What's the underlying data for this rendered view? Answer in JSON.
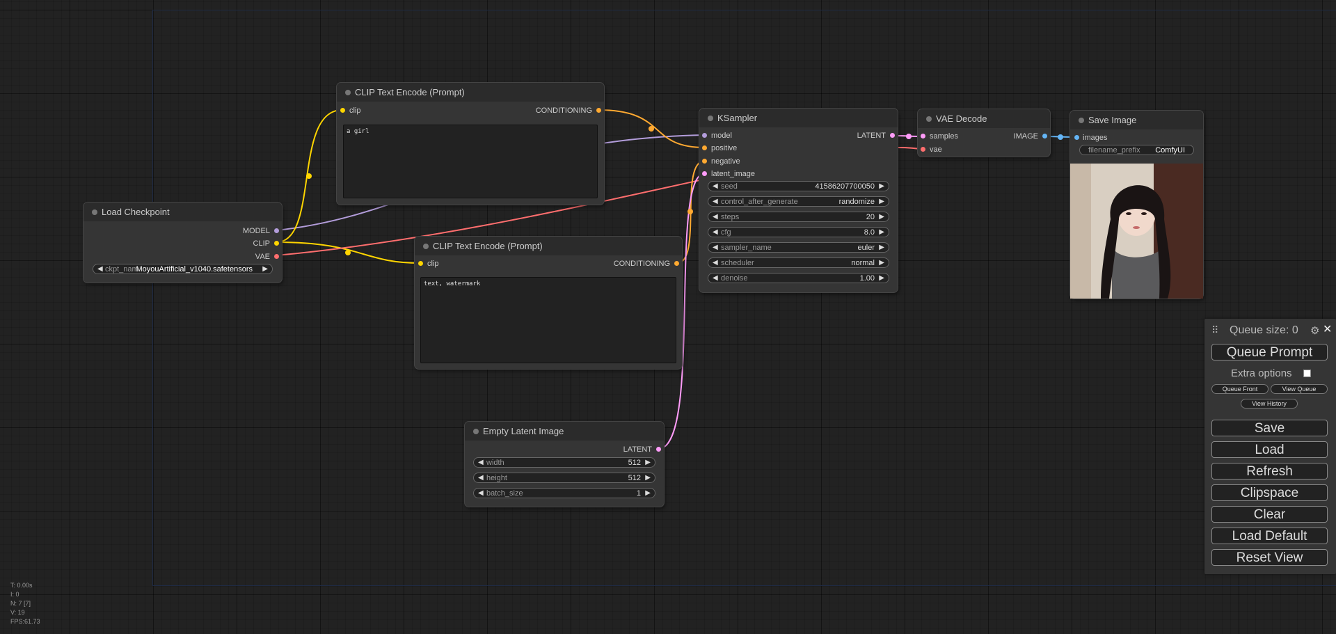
{
  "nodes": {
    "clip_top": {
      "title": "CLIP Text Encode (Prompt)",
      "input": "clip",
      "output": "CONDITIONING",
      "text": "a girl"
    },
    "clip_bottom": {
      "title": "CLIP Text Encode (Prompt)",
      "input": "clip",
      "output": "CONDITIONING",
      "text": "text, watermark"
    },
    "load_checkpoint": {
      "title": "Load Checkpoint",
      "outputs": [
        "MODEL",
        "CLIP",
        "VAE"
      ],
      "ckpt_label": "ckpt_nam",
      "ckpt_value": "MoyouArtificial_v1040.safetensors"
    },
    "ksampler": {
      "title": "KSampler",
      "inputs": [
        "model",
        "positive",
        "negative",
        "latent_image"
      ],
      "output": "LATENT",
      "widgets": [
        {
          "label": "seed",
          "value": "41586207700050"
        },
        {
          "label": "control_after_generate",
          "value": "randomize"
        },
        {
          "label": "steps",
          "value": "20"
        },
        {
          "label": "cfg",
          "value": "8.0"
        },
        {
          "label": "sampler_name",
          "value": "euler"
        },
        {
          "label": "scheduler",
          "value": "normal"
        },
        {
          "label": "denoise",
          "value": "1.00"
        }
      ]
    },
    "vae_decode": {
      "title": "VAE Decode",
      "inputs": [
        "samples",
        "vae"
      ],
      "output": "IMAGE"
    },
    "save_image": {
      "title": "Save Image",
      "input": "images",
      "prefix_label": "filename_prefix",
      "prefix_value": "ComfyUI"
    },
    "empty_latent": {
      "title": "Empty Latent Image",
      "output": "LATENT",
      "widgets": [
        {
          "label": "width",
          "value": "512"
        },
        {
          "label": "height",
          "value": "512"
        },
        {
          "label": "batch_size",
          "value": "1"
        }
      ]
    }
  },
  "panel": {
    "queue_size": "Queue size: 0",
    "queue_prompt": "Queue Prompt",
    "extra_options": "Extra options",
    "queue_front": "Queue Front",
    "view_queue": "View Queue",
    "view_history": "View History",
    "buttons": [
      "Save",
      "Load",
      "Refresh",
      "Clipspace",
      "Clear",
      "Load Default",
      "Reset View"
    ]
  },
  "stats": [
    "T: 0.00s",
    "I: 0",
    "N: 7 [7]",
    "V: 19",
    "FPS:61.73"
  ],
  "colors": {
    "model": "#b39ddb",
    "clip": "#ffd500",
    "vae": "#ff6e6e",
    "conditioning": "#ffa931",
    "latent": "#ff9cf9",
    "image": "#64b5f6"
  }
}
